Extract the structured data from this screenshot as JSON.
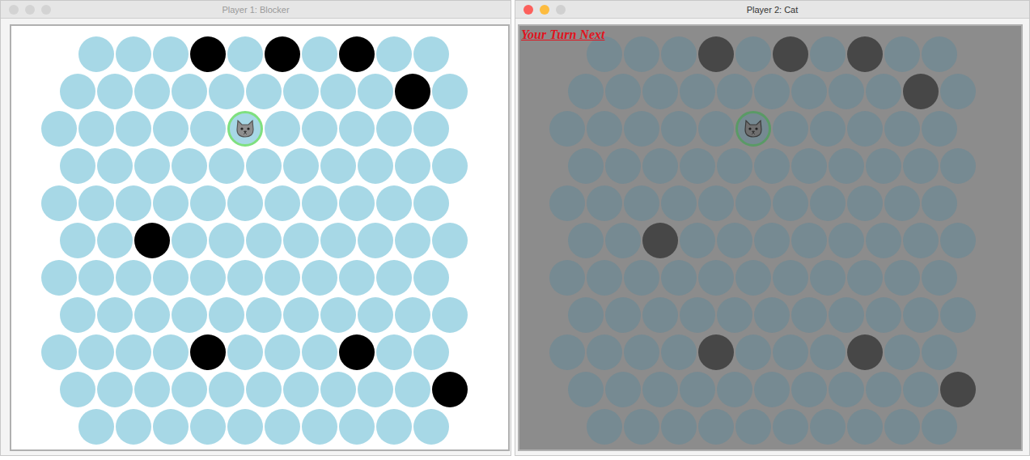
{
  "windows": [
    {
      "title": "Player 1: Blocker",
      "active": false,
      "dimmed": false
    },
    {
      "title": "Player 2: Cat",
      "active": true,
      "dimmed": true,
      "notice": "Your Turn Next"
    }
  ],
  "board": {
    "rows": [
      [
        "open",
        "open",
        "open",
        "blocked",
        "open",
        "blocked",
        "open",
        "blocked",
        "open",
        "open"
      ],
      [
        "open",
        "open",
        "open",
        "open",
        "open",
        "open",
        "open",
        "open",
        "open",
        "blocked",
        "open"
      ],
      [
        "open",
        "open",
        "open",
        "open",
        "open",
        "cat",
        "open",
        "open",
        "open",
        "open",
        "open"
      ],
      [
        "open",
        "open",
        "open",
        "open",
        "open",
        "open",
        "open",
        "open",
        "open",
        "open",
        "open"
      ],
      [
        "open",
        "open",
        "open",
        "open",
        "open",
        "open",
        "open",
        "open",
        "open",
        "open",
        "open"
      ],
      [
        "open",
        "open",
        "blocked",
        "open",
        "open",
        "open",
        "open",
        "open",
        "open",
        "open",
        "open"
      ],
      [
        "open",
        "open",
        "open",
        "open",
        "open",
        "open",
        "open",
        "open",
        "open",
        "open",
        "open"
      ],
      [
        "open",
        "open",
        "open",
        "open",
        "open",
        "open",
        "open",
        "open",
        "open",
        "open",
        "open"
      ],
      [
        "open",
        "open",
        "open",
        "open",
        "blocked",
        "open",
        "open",
        "open",
        "blocked",
        "open",
        "open"
      ],
      [
        "open",
        "open",
        "open",
        "open",
        "open",
        "open",
        "open",
        "open",
        "open",
        "open",
        "blocked"
      ],
      [
        "open",
        "open",
        "open",
        "open",
        "open",
        "open",
        "open",
        "open",
        "open",
        "open"
      ]
    ]
  }
}
